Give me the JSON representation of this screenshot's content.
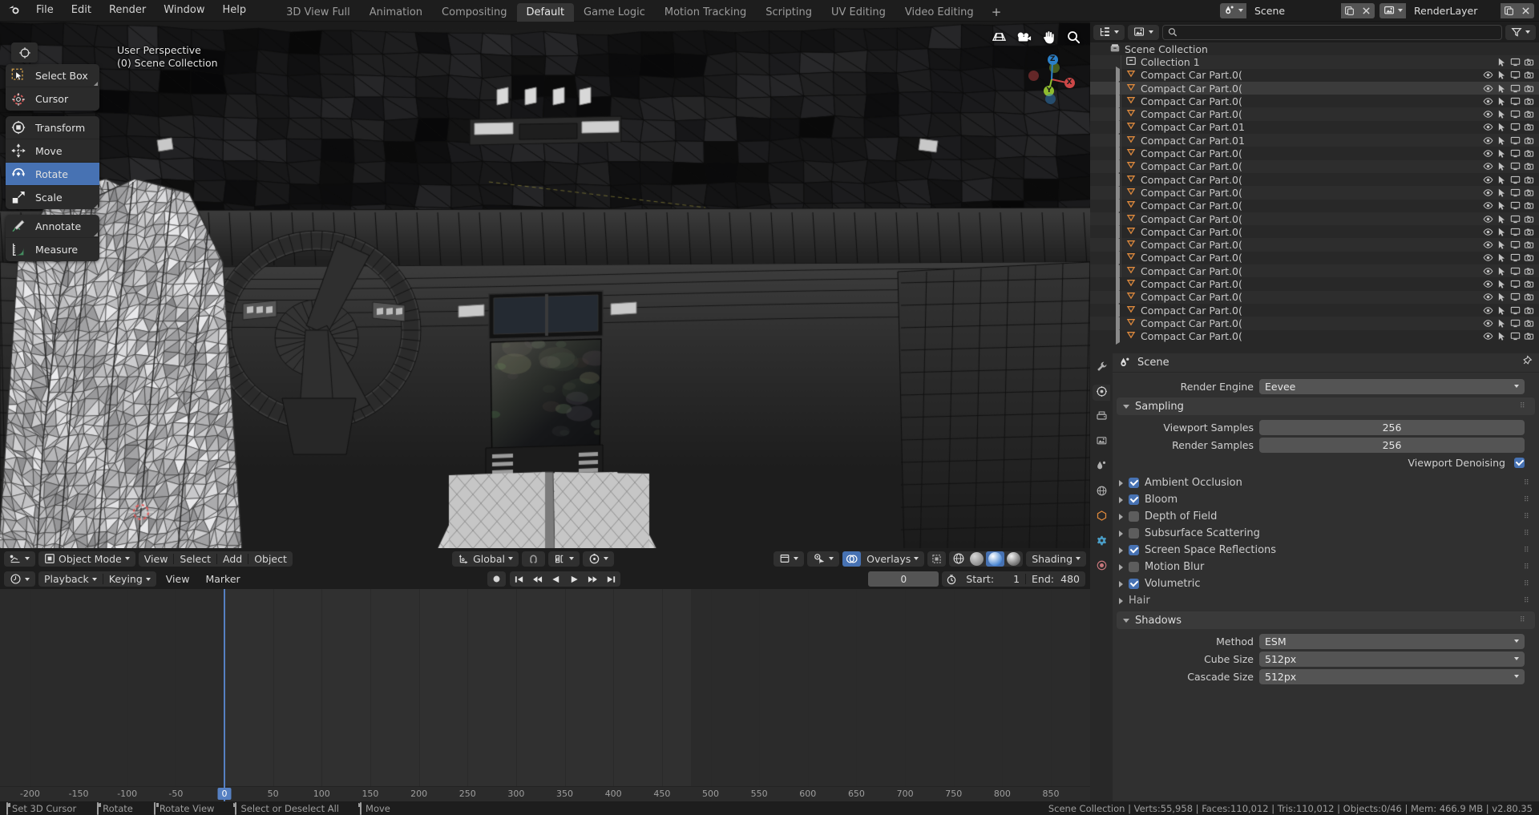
{
  "app": {
    "name": "Blender",
    "version": "v2.80.35"
  },
  "topbar": {
    "menus": [
      "File",
      "Edit",
      "Render",
      "Window",
      "Help"
    ],
    "workspaces": [
      {
        "label": "3D View Full",
        "active": false
      },
      {
        "label": "Animation",
        "active": false
      },
      {
        "label": "Compositing",
        "active": false
      },
      {
        "label": "Default",
        "active": true
      },
      {
        "label": "Game Logic",
        "active": false
      },
      {
        "label": "Motion Tracking",
        "active": false
      },
      {
        "label": "Scripting",
        "active": false
      },
      {
        "label": "UV Editing",
        "active": false
      },
      {
        "label": "Video Editing",
        "active": false
      }
    ],
    "add_workspace_label": "+",
    "scene": {
      "icon": "scene-icon",
      "name": "Scene",
      "new_label": "new-scene-icon",
      "close_label": "close-icon"
    },
    "viewlayer": {
      "icon": "viewlayer-icon",
      "name": "RenderLayer",
      "new_label": "new-layer-icon",
      "close_label": "close-icon"
    }
  },
  "viewport": {
    "perspective_label": "User Perspective",
    "collection_label": "(0) Scene Collection",
    "gizmo_icons": [
      "grid-icon",
      "camera-icon",
      "hand-icon",
      "zoom-icon"
    ],
    "nav_axes": [
      {
        "label": "Z",
        "color": "#2b80c8"
      },
      {
        "label": "Y",
        "color": "#8fbc2f"
      },
      {
        "label": "X",
        "color": "#cd4747"
      }
    ],
    "toolbar": [
      {
        "label": "Select Box",
        "icon": "select-box-icon",
        "active": false,
        "corner": true,
        "group": 0
      },
      {
        "label": "Cursor",
        "icon": "cursor-icon",
        "active": false,
        "corner": false,
        "group": 0
      },
      {
        "label": "Transform",
        "icon": "transform-icon",
        "active": false,
        "corner": false,
        "group": 1
      },
      {
        "label": "Move",
        "icon": "move-icon",
        "active": false,
        "corner": false,
        "group": 1
      },
      {
        "label": "Rotate",
        "icon": "rotate-icon",
        "active": true,
        "corner": false,
        "group": 1
      },
      {
        "label": "Scale",
        "icon": "scale-icon",
        "active": false,
        "corner": true,
        "group": 1
      },
      {
        "label": "Annotate",
        "icon": "annotate-icon",
        "active": false,
        "corner": true,
        "group": 2
      },
      {
        "label": "Measure",
        "icon": "measure-icon",
        "active": false,
        "corner": false,
        "group": 2
      }
    ],
    "header": {
      "editor_icon": "editor-type-icon",
      "mode": "Object Mode",
      "menus": [
        "View",
        "Select",
        "Add",
        "Object"
      ],
      "orientation": "Global",
      "snap_icon": "snap-magnet-icon",
      "snap_target_icon": "snap-target-icon",
      "proportional_icon": "proportional-edit-icon",
      "visibility_icon": "object-visibility-icon",
      "gizmo_icon": "gizmo-icon",
      "overlays_label": "Overlays",
      "xray_icon": "xray-icon",
      "shading_label": "Shading",
      "shading_modes": [
        "wireframe",
        "solid",
        "material-preview",
        "rendered"
      ],
      "shading_active_index": 2
    }
  },
  "timeline": {
    "editor_icon": "timeline-editor-icon",
    "menus": [
      "Playback",
      "Keying",
      "View",
      "Marker"
    ],
    "transport": [
      "record-icon",
      "jump-start-icon",
      "prev-keyframe-icon",
      "play-reverse-icon",
      "play-icon",
      "next-keyframe-icon",
      "jump-end-icon"
    ],
    "current_frame": "0",
    "autokey_icon": "auto-keying-icon",
    "start_label": "Start:",
    "start_value": "1",
    "end_label": "End:",
    "end_value": "480",
    "ruler_ticks": [
      "-200",
      "-150",
      "-100",
      "-50",
      "0",
      "50",
      "100",
      "150",
      "200",
      "250",
      "300",
      "350",
      "400",
      "450",
      "500",
      "550",
      "600",
      "650",
      "700",
      "750",
      "800",
      "850"
    ],
    "playhead_frame": "0"
  },
  "outliner": {
    "display_mode_icon": "outliner-display-mode-icon",
    "filter_id_icon": "id-type-filter-icon",
    "search_icon": "search-icon",
    "search_value": "",
    "search_placeholder": "",
    "filter_icon": "filter-funnel-icon",
    "root": {
      "label": "Scene Collection",
      "icon": "scene-collection-icon"
    },
    "collection": {
      "label": "Collection 1",
      "icon": "collection-icon"
    },
    "objects": [
      "Compact Car Part.0(",
      "Compact Car Part.0(",
      "Compact Car Part.0(",
      "Compact Car Part.0(",
      "Compact Car Part.01",
      "Compact Car Part.01",
      "Compact Car Part.0(",
      "Compact Car Part.0(",
      "Compact Car Part.0(",
      "Compact Car Part.0(",
      "Compact Car Part.0(",
      "Compact Car Part.0(",
      "Compact Car Part.0(",
      "Compact Car Part.0(",
      "Compact Car Part.0(",
      "Compact Car Part.0(",
      "Compact Car Part.0(",
      "Compact Car Part.0(",
      "Compact Car Part.0(",
      "Compact Car Part.0(",
      "Compact Car Part.0("
    ],
    "selected_index": 1,
    "row_icons": [
      "eye-icon",
      "cursor-select-icon",
      "monitor-icon",
      "camera-render-icon"
    ]
  },
  "properties": {
    "tabs": [
      "tool-icon",
      "render-icon",
      "output-icon",
      "viewlayer-icon",
      "scene-icon",
      "world-icon",
      "object-icon",
      "modifier-icon",
      "material-icon"
    ],
    "active_tab_index": 1,
    "breadcrumb": {
      "icon": "scene-icon",
      "label": "Scene",
      "pin_icon": "pin-icon"
    },
    "render_engine_label": "Render Engine",
    "render_engine_value": "Eevee",
    "sampling": {
      "title": "Sampling",
      "rows": [
        {
          "label": "Viewport Samples",
          "value": "256"
        },
        {
          "label": "Render Samples",
          "value": "256"
        }
      ],
      "denoising_label": "Viewport Denoising",
      "denoising_checked": true
    },
    "effects": [
      {
        "label": "Ambient Occlusion",
        "checked": true
      },
      {
        "label": "Bloom",
        "checked": true
      },
      {
        "label": "Depth of Field",
        "checked": false
      },
      {
        "label": "Subsurface Scattering",
        "checked": false
      },
      {
        "label": "Screen Space Reflections",
        "checked": true
      },
      {
        "label": "Motion Blur",
        "checked": false
      },
      {
        "label": "Volumetric",
        "checked": true
      }
    ],
    "hair_label": "Hair",
    "shadows": {
      "title": "Shadows",
      "rows": [
        {
          "label": "Method",
          "value": "ESM"
        },
        {
          "label": "Cube Size",
          "value": "512px"
        },
        {
          "label": "Cascade Size",
          "value": "512px"
        }
      ]
    }
  },
  "statusbar": {
    "hints": [
      {
        "mouse": "left",
        "label": "Set 3D Cursor"
      },
      {
        "mouse": "left-drag",
        "label": "Rotate"
      },
      {
        "mouse": "middle",
        "label": "Rotate View"
      },
      {
        "mouse": "right",
        "label": "Select or Deselect All"
      },
      {
        "mouse": "right-drag",
        "label": "Move"
      }
    ],
    "stats": "Scene Collection | Verts:55,958 | Faces:110,012 | Tris:110,012 | Objects:0/46 | Mem: 466.9 MB | v2.80.35"
  },
  "colors": {
    "accent": "#4772b3",
    "background": "#1d1d1d",
    "panel": "#303030",
    "object_orange": "#e08a3c"
  }
}
